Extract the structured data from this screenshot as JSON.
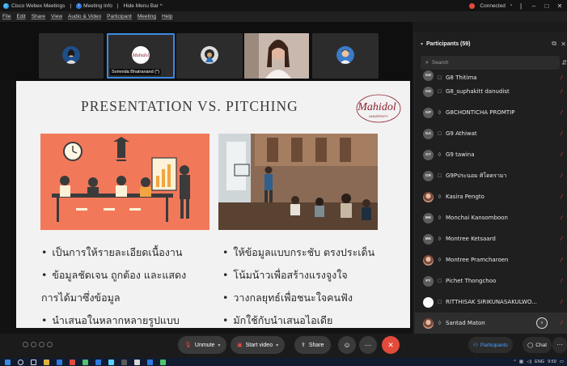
{
  "titlebar": {
    "app_name": "Cisco Webex Meetings",
    "meeting_info": "Meeting Info",
    "hide_menu": "Hide Menu Bar ^",
    "status": "Connected",
    "minimize": "–",
    "maximize": "□",
    "close": "✕"
  },
  "menu": [
    "File",
    "Edit",
    "Share",
    "View",
    "Audio & Video",
    "Participant",
    "Meeting",
    "Help"
  ],
  "thumbnails": {
    "active_label": "Somnida Bhatranand",
    "active_label_suffix": "(*)"
  },
  "slide": {
    "title": "PRESENTATION VS. PITCHING",
    "logo_text": "Mahidol",
    "logo_subtext": "UNIVERSITY",
    "left_bullets": [
      {
        "text": "เป็นการให้รายละเอียดเนื้องาน",
        "cont": false
      },
      {
        "text": "ข้อมูลชัดเจน ถูกต้อง และแสดง",
        "cont": false
      },
      {
        "text": "การได้มาซึ่งข้อมูล",
        "cont": true
      },
      {
        "text": "นำเสนอในหลากหลายรูปแบบ",
        "cont": false
      }
    ],
    "right_bullets": [
      {
        "text": "ให้ข้อมูลแบบกระชับ ตรงประเด็น",
        "cont": false
      },
      {
        "text": "โน้มน้าวเพื่อสร้างแรงจูงใจ",
        "cont": false
      },
      {
        "text": "วางกลยุทธ์เพื่อชนะใจคนฟัง",
        "cont": false
      },
      {
        "text": "มักใช้กับนำเสนอไอเดีย",
        "cont": false
      }
    ]
  },
  "controls": {
    "unmute": "Unmute",
    "start_video": "Start video",
    "share": "Share",
    "reactions_icon": "emoji-icon",
    "more": "···",
    "end": "✕"
  },
  "panel": {
    "title": "Participants (59)",
    "search_placeholder": "Search",
    "participants": [
      {
        "initials": "GD",
        "name": "G8 Thitima",
        "avatar": "initials",
        "device": "□",
        "partial": true
      },
      {
        "initials": "GD",
        "name": "G8_suphakitt danudist",
        "avatar": "initials",
        "device": "□"
      },
      {
        "initials": "GP",
        "name": "G8CHONTICHA PROMTIP",
        "avatar": "initials",
        "device": "◊"
      },
      {
        "initials": "GA",
        "name": "G9 Athiwat",
        "avatar": "initials",
        "device": "□"
      },
      {
        "initials": "GT",
        "name": "G9 tawina",
        "avatar": "initials",
        "device": "◊"
      },
      {
        "initials": "GR",
        "name": "G9Pประนอม ศิโตตรามา",
        "avatar": "initials",
        "device": "□"
      },
      {
        "initials": "",
        "name": "Kasira Pengto",
        "avatar": "photo",
        "device": "◊"
      },
      {
        "initials": "MK",
        "name": "Monchai Kansomboon",
        "avatar": "initials",
        "device": "◊"
      },
      {
        "initials": "MK",
        "name": "Montree Ketsaard",
        "avatar": "initials",
        "device": "◊"
      },
      {
        "initials": "",
        "name": "Montree Pramcharoen",
        "avatar": "photo",
        "device": "◊"
      },
      {
        "initials": "PT",
        "name": "Pichet Thongchoo",
        "avatar": "initials",
        "device": "□"
      },
      {
        "initials": "",
        "name": "RITTHISAK SIRIKUNASAKULWO...",
        "avatar": "white",
        "device": "□"
      },
      {
        "initials": "",
        "name": "Santad Maton",
        "avatar": "photo",
        "device": "◊",
        "highlight": true
      }
    ]
  },
  "panel_bottom": {
    "participants": "Participants",
    "chat": "Chat",
    "more": "···"
  },
  "taskbar": {
    "lang": "ENG",
    "time": "9:59"
  },
  "colors": {
    "accent_blue": "#3b89e0",
    "mute_red": "#e24b3b",
    "slide_bg": "#f2f2f2",
    "illustration_orange": "#f2785a"
  }
}
